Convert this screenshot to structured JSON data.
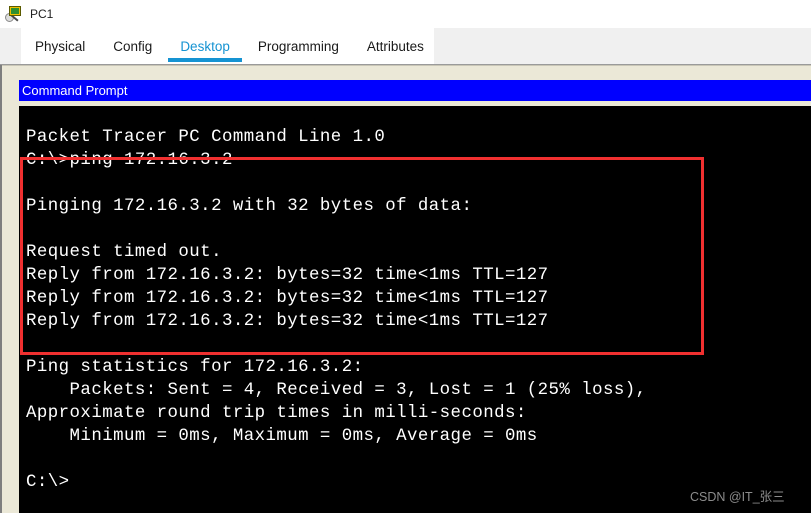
{
  "window": {
    "title": "PC1",
    "icon": "pc-device-icon"
  },
  "tabs": [
    {
      "label": "Physical",
      "active": false
    },
    {
      "label": "Config",
      "active": false
    },
    {
      "label": "Desktop",
      "active": true
    },
    {
      "label": "Programming",
      "active": false
    },
    {
      "label": "Attributes",
      "active": false
    }
  ],
  "command_prompt": {
    "header_title": "Command Prompt",
    "banner": "Packet Tracer PC Command Line 1.0",
    "lines": [
      "Packet Tracer PC Command Line 1.0",
      "C:\\>ping 172.16.3.2",
      "",
      "Pinging 172.16.3.2 with 32 bytes of data:",
      "",
      "Request timed out.",
      "Reply from 172.16.3.2: bytes=32 time<1ms TTL=127",
      "Reply from 172.16.3.2: bytes=32 time<1ms TTL=127",
      "Reply from 172.16.3.2: bytes=32 time<1ms TTL=127",
      "",
      "Ping statistics for 172.16.3.2:",
      "    Packets: Sent = 4, Received = 3, Lost = 1 (25% loss),",
      "Approximate round trip times in milli-seconds:",
      "    Minimum = 0ms, Maximum = 0ms, Average = 0ms",
      "",
      "C:\\>"
    ],
    "command": "ping 172.16.3.2",
    "target_ip": "172.16.3.2",
    "packet_size_bytes": "32",
    "statistics": {
      "sent": "4",
      "received": "3",
      "lost": "1",
      "loss_percent": "25%",
      "minimum_ms": "0ms",
      "maximum_ms": "0ms",
      "average_ms": "0ms",
      "ttl": "127"
    },
    "prompt": "C:\\>"
  },
  "annotation": {
    "color": "#f03030",
    "shape": "rectangle"
  },
  "watermark": {
    "text": "CSDN @IT_张三"
  },
  "colors": {
    "accent": "#1593d2",
    "header_blue": "#0000ff",
    "panel_beige": "#ebe8d7",
    "terminal_bg": "#000000",
    "terminal_fg": "#ffffff",
    "annotation_red": "#f03030"
  }
}
